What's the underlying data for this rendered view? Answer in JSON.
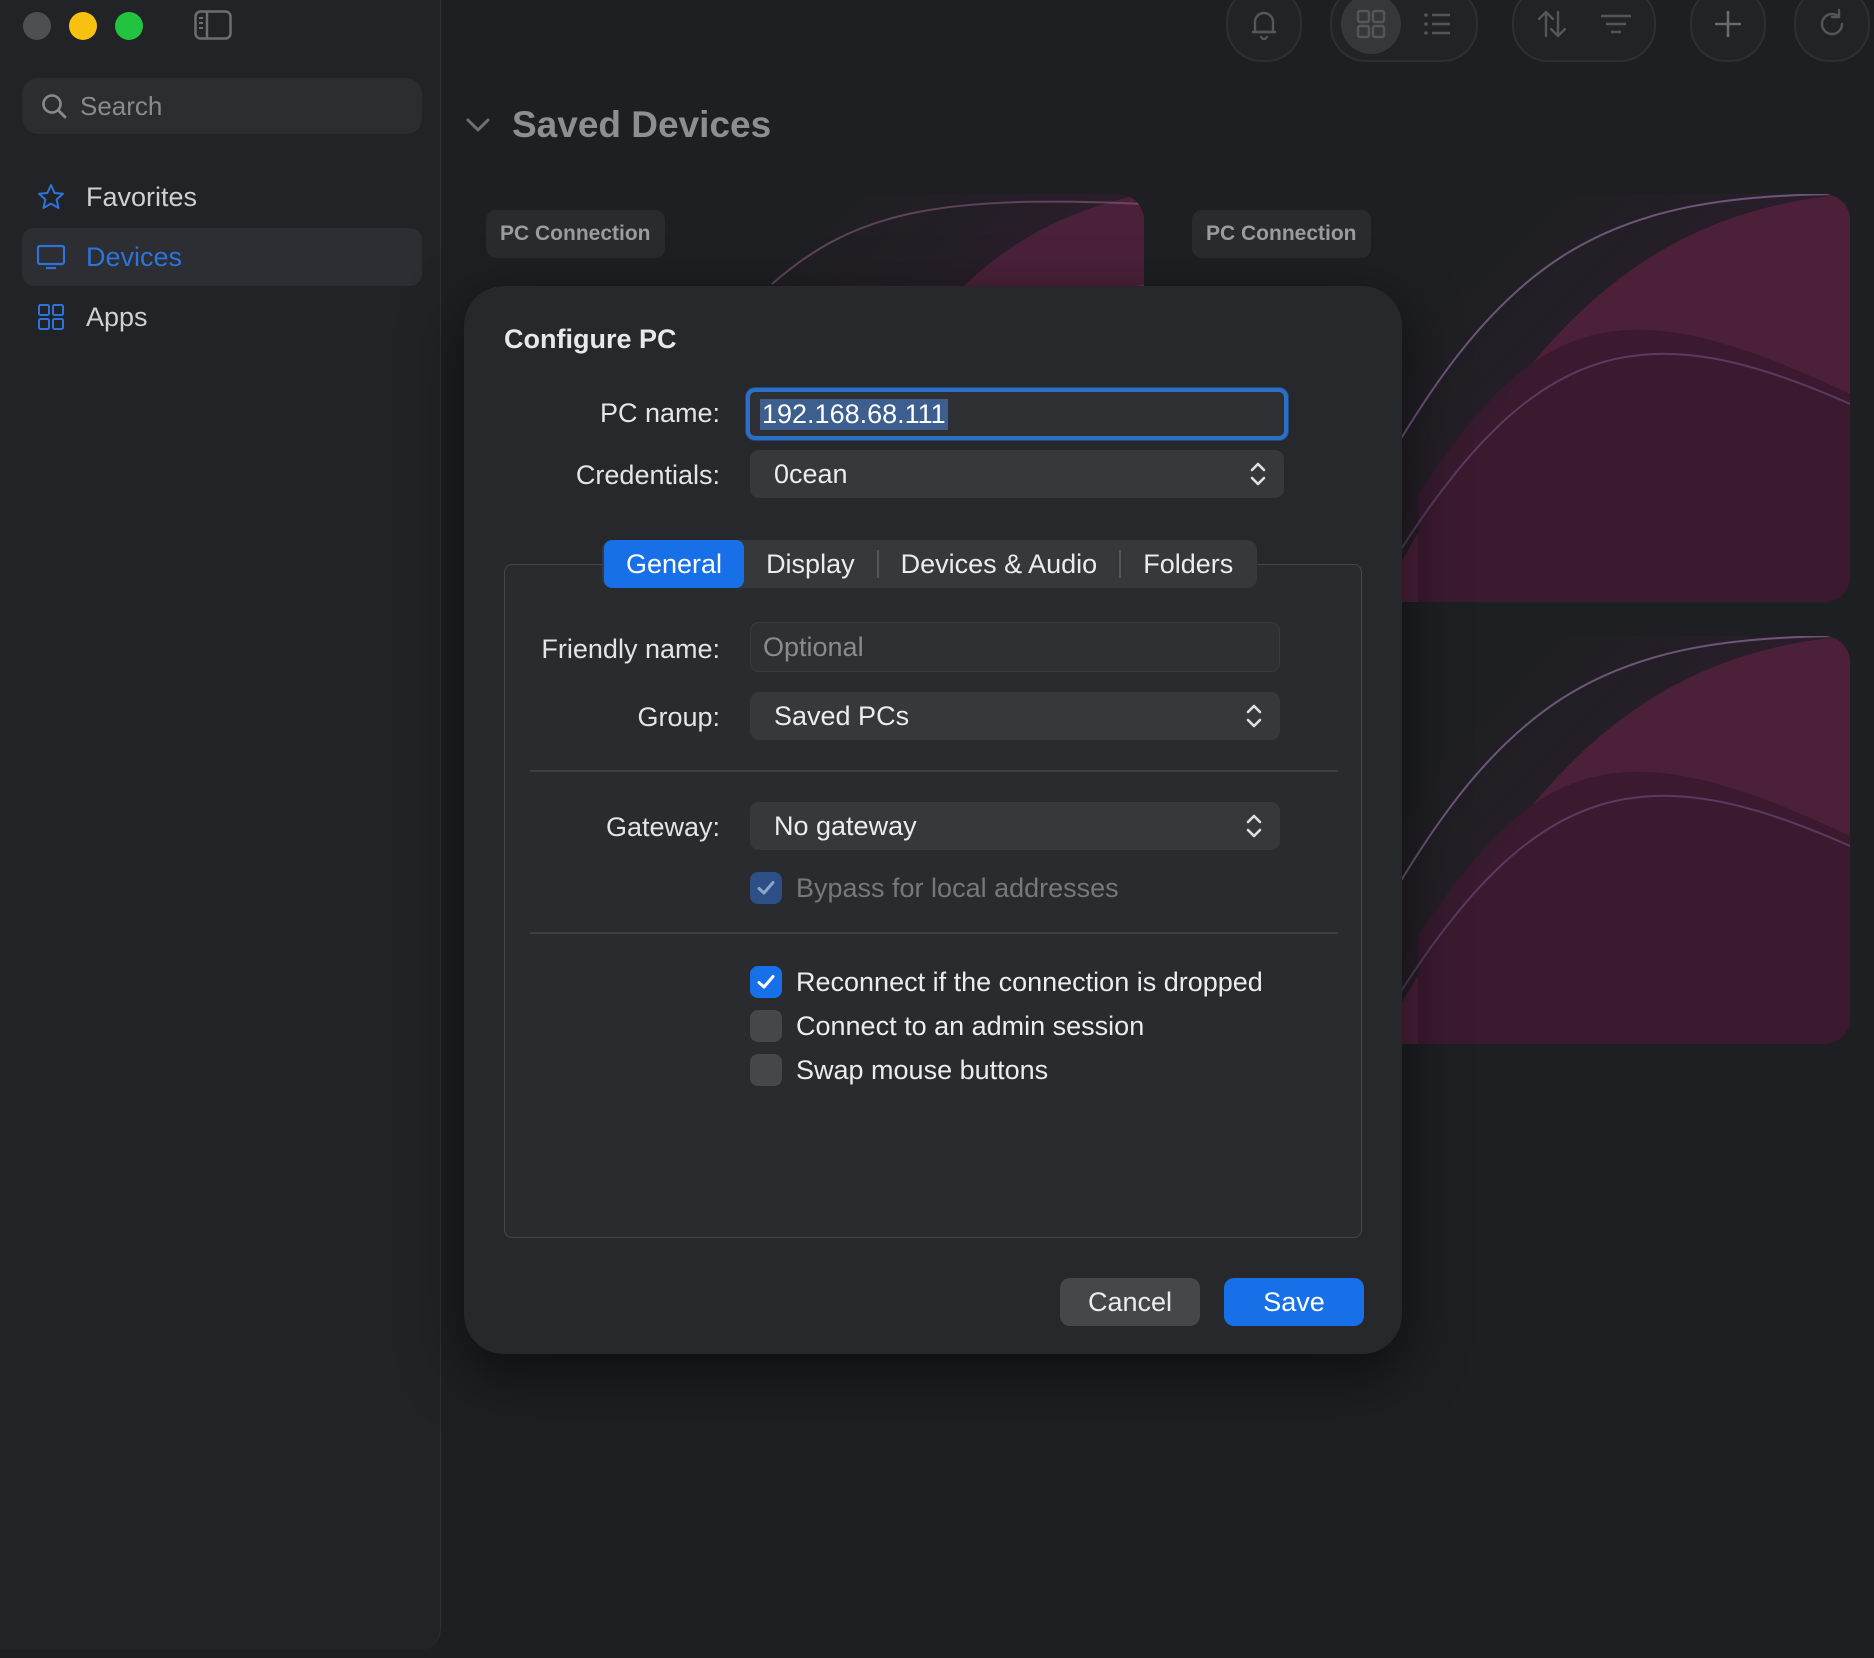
{
  "sidebar": {
    "search": {
      "placeholder": "Search"
    },
    "items": [
      {
        "label": "Favorites",
        "icon": "star-icon"
      },
      {
        "label": "Devices",
        "icon": "monitor-icon",
        "active": true
      },
      {
        "label": "Apps",
        "icon": "apps-icon"
      }
    ]
  },
  "toolbar": {
    "icons": [
      "bell-icon",
      "grid-view-icon",
      "list-view-icon",
      "sort-icon",
      "filter-icon",
      "add-icon",
      "refresh-icon"
    ]
  },
  "main": {
    "section_title": "Saved Devices",
    "cards": [
      {
        "badge": "PC Connection"
      },
      {
        "badge": "PC Connection"
      }
    ]
  },
  "dialog": {
    "title": "Configure PC",
    "pc_name": {
      "label": "PC name:",
      "value": "192.168.68.111"
    },
    "credentials": {
      "label": "Credentials:",
      "value": "0cean"
    },
    "tabs": [
      {
        "label": "General",
        "active": true
      },
      {
        "label": "Display"
      },
      {
        "label": "Devices & Audio"
      },
      {
        "label": "Folders"
      }
    ],
    "friendly_name": {
      "label": "Friendly name:",
      "placeholder": "Optional",
      "value": ""
    },
    "group": {
      "label": "Group:",
      "value": "Saved PCs"
    },
    "gateway": {
      "label": "Gateway:",
      "value": "No gateway"
    },
    "bypass": {
      "label": "Bypass for local addresses",
      "checked": true,
      "enabled": false
    },
    "options": [
      {
        "label": "Reconnect if the connection is dropped",
        "checked": true
      },
      {
        "label": "Connect to an admin session",
        "checked": false
      },
      {
        "label": "Swap mouse buttons",
        "checked": false
      }
    ],
    "cancel_label": "Cancel",
    "save_label": "Save"
  },
  "colors": {
    "accent": "#1870e8",
    "sidebar_active_text": "#2e74d8",
    "traffic_close": "#4e4f52",
    "traffic_minimize": "#f6c10f",
    "traffic_maximize": "#22c33f"
  }
}
